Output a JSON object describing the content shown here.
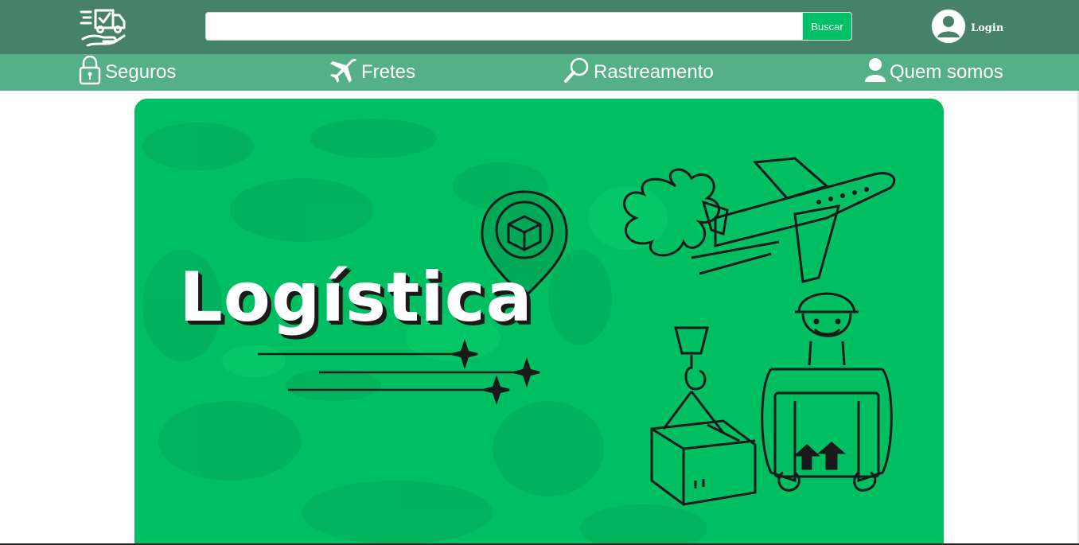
{
  "header": {
    "logo_icon": "delivery-truck-hand-icon",
    "search": {
      "placeholder": "",
      "value": "",
      "button_label": "Buscar"
    },
    "login": {
      "label": "Login",
      "icon": "user-avatar-icon"
    }
  },
  "nav": {
    "items": [
      {
        "label": "Seguros",
        "icon": "lock-icon"
      },
      {
        "label": "Fretes",
        "icon": "airplane-icon"
      },
      {
        "label": "Rastreamento",
        "icon": "magnifier-icon"
      },
      {
        "label": "Quem somos",
        "icon": "user-icon"
      }
    ]
  },
  "banner": {
    "title": "Logística",
    "background_color": "#00bf63"
  },
  "colors": {
    "topbar": "#46816a",
    "navbar": "#56b085",
    "accent": "#00c067"
  }
}
